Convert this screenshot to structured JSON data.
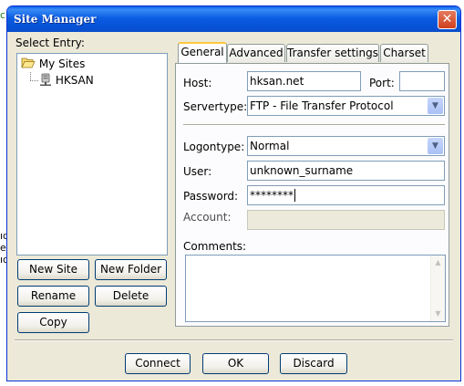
{
  "background": {
    "fragments": [
      "c",
      "ıd",
      "e",
      "ıd"
    ]
  },
  "window": {
    "title": "Site Manager",
    "close_glyph": "✕",
    "colors": {
      "titlebar": "#0653d8",
      "dialog": "#ece9d8",
      "tab_highlight": "#ffc83c"
    }
  },
  "tree": {
    "label": "Select Entry:",
    "root": {
      "label": "My Sites",
      "icon": "folder-open-icon"
    },
    "items": [
      {
        "label": "HKSAN",
        "icon": "server-icon"
      }
    ]
  },
  "left_buttons": {
    "new_site": "New Site",
    "new_folder": "New Folder",
    "rename": "Rename",
    "delete": "Delete",
    "copy": "Copy"
  },
  "tabs": [
    "General",
    "Advanced",
    "Transfer settings",
    "Charset"
  ],
  "general": {
    "host_label": "Host:",
    "host_value": "hksan.net",
    "port_label": "Port:",
    "port_value": "",
    "servertype_label": "Servertype:",
    "servertype_value": "FTP - File Transfer Protocol",
    "logontype_label": "Logontype:",
    "logontype_value": "Normal",
    "user_label": "User:",
    "user_value": "unknown_surname",
    "password_label": "Password:",
    "password_value": "********",
    "account_label": "Account:",
    "account_value": "",
    "comments_label": "Comments:",
    "comments_value": ""
  },
  "footer": {
    "connect": "Connect",
    "ok": "OK",
    "discard": "Discard"
  }
}
